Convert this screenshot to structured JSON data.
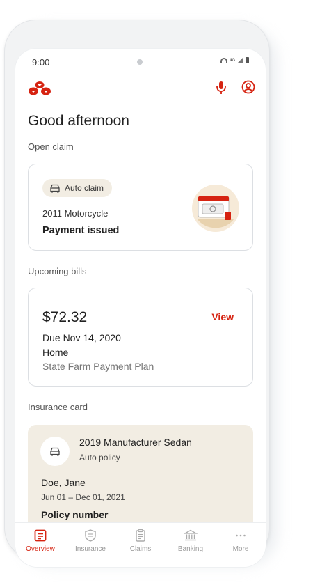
{
  "status_bar": {
    "time": "9:00",
    "network": "4G"
  },
  "colors": {
    "brand": "#d62311",
    "chip_bg": "#f2ede3",
    "text": "#222222"
  },
  "header": {
    "logo": "state-farm-logo",
    "icons": [
      "mic-icon",
      "profile-icon"
    ]
  },
  "greeting": "Good afternoon",
  "open_claim": {
    "section_title": "Open claim",
    "chip_label": "Auto claim",
    "vehicle": "2011 Motorcycle",
    "status": "Payment issued"
  },
  "bills": {
    "section_title": "Upcoming bills",
    "amount": "$72.32",
    "action_label": "View",
    "due": "Due Nov 14, 2020",
    "type": "Home",
    "plan": "State Farm Payment Plan"
  },
  "insurance_card": {
    "section_title": "Insurance card",
    "vehicle": "2019 Manufacturer Sedan",
    "policy_type": "Auto policy",
    "holder": "Doe, Jane",
    "period": "Jun 01 – Dec 01, 2021",
    "policy_number_label": "Policy number"
  },
  "nav": {
    "items": [
      {
        "label": "Overview",
        "icon": "overview-icon",
        "active": true
      },
      {
        "label": "Insurance",
        "icon": "shield-icon",
        "active": false
      },
      {
        "label": "Claims",
        "icon": "clipboard-icon",
        "active": false
      },
      {
        "label": "Banking",
        "icon": "bank-icon",
        "active": false
      },
      {
        "label": "More",
        "icon": "more-icon",
        "active": false
      }
    ]
  }
}
